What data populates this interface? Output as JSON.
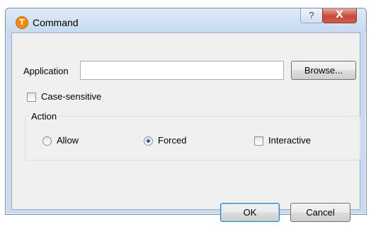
{
  "window": {
    "title": "Command",
    "help_glyph": "?",
    "close_glyph": "X",
    "app_icon": "torch-t-icon"
  },
  "form": {
    "application_label": "Application",
    "application_value": "",
    "browse_label": "Browse...",
    "case_sensitive_label": "Case-sensitive",
    "case_sensitive_checked": false
  },
  "action": {
    "group_title": "Action",
    "allow_label": "Allow",
    "allow_selected": false,
    "forced_label": "Forced",
    "forced_selected": true,
    "interactive_label": "Interactive",
    "interactive_checked": false
  },
  "footer": {
    "ok_label": "OK",
    "cancel_label": "Cancel"
  }
}
